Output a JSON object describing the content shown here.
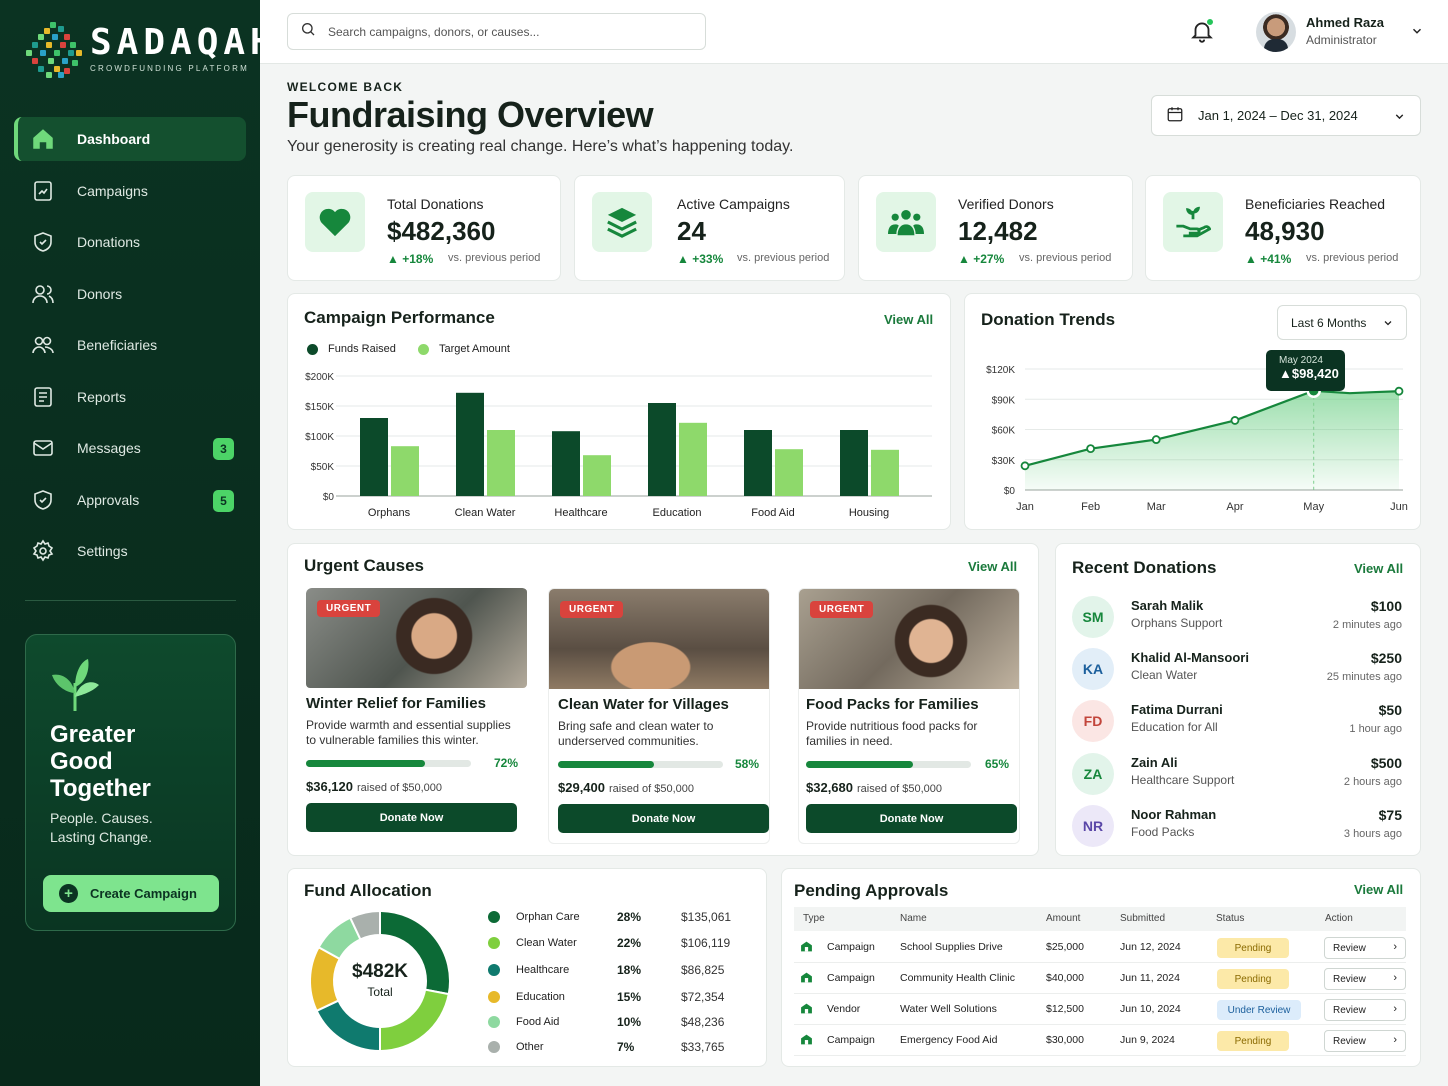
{
  "app": {
    "name": "SADAQAH",
    "tagline": "CROWDFUNDING PLATFORM"
  },
  "sidebar": {
    "items": [
      {
        "label": "Dashboard",
        "icon": "home-icon",
        "active": true
      },
      {
        "label": "Campaigns",
        "icon": "campaign-icon"
      },
      {
        "label": "Donations",
        "icon": "shield-heart-icon"
      },
      {
        "label": "Donors",
        "icon": "users-icon"
      },
      {
        "label": "Beneficiaries",
        "icon": "people-icon"
      },
      {
        "label": "Reports",
        "icon": "report-icon"
      },
      {
        "label": "Messages",
        "icon": "mail-icon",
        "badge": "3"
      },
      {
        "label": "Approvals",
        "icon": "shield-check-icon",
        "badge": "5"
      },
      {
        "label": "Settings",
        "icon": "gear-icon"
      }
    ],
    "promo": {
      "title": "Greater\nGood\nTogether",
      "subtitle": "People. Causes.\nLasting Change.",
      "button": "Create Campaign"
    }
  },
  "topbar": {
    "search_placeholder": "Search campaigns, donors, or causes...",
    "user": {
      "name": "Ahmed Raza",
      "role": "Administrator"
    }
  },
  "header": {
    "welcome": "WELCOME BACK",
    "title": "Fundraising Overview",
    "subtitle": "Your generosity is creating real change. Here’s what’s happening today.",
    "date_range": "Jan 1, 2024 – Dec 31, 2024"
  },
  "stats": [
    {
      "label": "Total Donations",
      "value": "$482,360",
      "change": "+18%",
      "note": "vs. previous period",
      "icon": "heart-icon"
    },
    {
      "label": "Active Campaigns",
      "value": "24",
      "change": "+33%",
      "note": "vs. previous period",
      "icon": "layers-icon"
    },
    {
      "label": "Verified Donors",
      "value": "12,482",
      "change": "+27%",
      "note": "vs. previous period",
      "icon": "group-icon"
    },
    {
      "label": "Beneficiaries Reached",
      "value": "48,930",
      "change": "+41%",
      "note": "vs. previous period",
      "icon": "hand-plant-icon"
    }
  ],
  "campaign_performance": {
    "title": "Campaign Performance",
    "view_all": "View All",
    "legend": [
      "Funds Raised",
      "Target Amount"
    ]
  },
  "donation_trends": {
    "title": "Donation Trends",
    "filter": "Last 6 Months",
    "tooltip": {
      "label": "May 2024",
      "value": "$98,420"
    }
  },
  "chart_data": [
    {
      "type": "bar",
      "categories": [
        "Orphans",
        "Clean Water",
        "Healthcare",
        "Education",
        "Food Aid",
        "Housing"
      ],
      "series": [
        {
          "name": "Funds Raised",
          "values": [
            130000,
            172000,
            108000,
            155000,
            110000,
            110000
          ]
        },
        {
          "name": "Target Amount",
          "values": [
            83000,
            110000,
            68000,
            122000,
            78000,
            77000
          ]
        }
      ],
      "yticks": [
        "$0",
        "$50K",
        "$100K",
        "$150K",
        "$200K"
      ],
      "ylim": [
        0,
        200000
      ],
      "colors": [
        "#0c4a2a",
        "#8ed96b"
      ]
    },
    {
      "type": "area",
      "x": [
        "Jan",
        "Feb",
        "Mar",
        "Apr",
        "May",
        "Jun"
      ],
      "xpos": [
        0,
        1,
        2,
        3.2,
        4.4,
        5.7
      ],
      "values": [
        24000,
        41000,
        50000,
        69000,
        98420,
        98000
      ],
      "extra_points": [
        {
          "x": 4.95,
          "y": 96000
        },
        {
          "x": 5.3,
          "y": 97000
        }
      ],
      "yticks": [
        "$0",
        "$30K",
        "$60K",
        "$90K",
        "$120K"
      ],
      "ylim": [
        0,
        120000
      ],
      "color": "#16873c"
    },
    {
      "type": "pie",
      "categories": [
        "Orphan Care",
        "Clean Water",
        "Healthcare",
        "Education",
        "Food Aid",
        "Other"
      ],
      "values": [
        28,
        22,
        18,
        15,
        10,
        7
      ],
      "colors": [
        "#0c6a36",
        "#7fcf3e",
        "#0f7a6e",
        "#e7b92a",
        "#8ed9a0",
        "#a9b0ac"
      ]
    }
  ],
  "urgent_causes": {
    "title": "Urgent Causes",
    "view_all": "View All",
    "tag": "URGENT",
    "items": [
      {
        "title": "Winter Relief for Families",
        "desc": "Provide warmth and essential supplies to vulnerable families this winter.",
        "progress": 0.72,
        "pct": "72%",
        "raised": "$36,120",
        "of": "raised of $50,000",
        "button": "Donate Now"
      },
      {
        "title": "Clean Water for Villages",
        "desc": "Bring safe and clean water to underserved communities.",
        "progress": 0.58,
        "pct": "58%",
        "raised": "$29,400",
        "of": "raised of $50,000",
        "button": "Donate Now"
      },
      {
        "title": "Food Packs for Families",
        "desc": "Provide nutritious food packs for families in need.",
        "progress": 0.65,
        "pct": "65%",
        "raised": "$32,680",
        "of": "raised of $50,000",
        "button": "Donate Now"
      }
    ]
  },
  "recent_donations": {
    "title": "Recent Donations",
    "view_all": "View All",
    "items": [
      {
        "initials": "SM",
        "name": "Sarah Malik",
        "cause": "Orphans Support",
        "amount": "$100",
        "time": "2 minutes ago",
        "bg": "#e2f4ea",
        "fg": "#16873c"
      },
      {
        "initials": "KA",
        "name": "Khalid Al-Mansoori",
        "cause": "Clean Water",
        "amount": "$250",
        "time": "25 minutes ago",
        "bg": "#e2eef8",
        "fg": "#1b5f9c"
      },
      {
        "initials": "FD",
        "name": "Fatima Durrani",
        "cause": "Education for All",
        "amount": "$50",
        "time": "1 hour ago",
        "bg": "#fbe6e4",
        "fg": "#c2453b"
      },
      {
        "initials": "ZA",
        "name": "Zain Ali",
        "cause": "Healthcare Support",
        "amount": "$500",
        "time": "2 hours ago",
        "bg": "#e2f4ea",
        "fg": "#16873c"
      },
      {
        "initials": "NR",
        "name": "Noor Rahman",
        "cause": "Food Packs",
        "amount": "$75",
        "time": "3 hours ago",
        "bg": "#ece8f8",
        "fg": "#5a47a8"
      }
    ]
  },
  "fund_allocation": {
    "title": "Fund Allocation",
    "center_value": "$482K",
    "center_label": "Total",
    "rows": [
      {
        "name": "Orphan Care",
        "pct": "28%",
        "amount": "$135,061"
      },
      {
        "name": "Clean Water",
        "pct": "22%",
        "amount": "$106,119"
      },
      {
        "name": "Healthcare",
        "pct": "18%",
        "amount": "$86,825"
      },
      {
        "name": "Education",
        "pct": "15%",
        "amount": "$72,354"
      },
      {
        "name": "Food Aid",
        "pct": "10%",
        "amount": "$48,236"
      },
      {
        "name": "Other",
        "pct": "7%",
        "amount": "$33,765"
      }
    ]
  },
  "pending_approvals": {
    "title": "Pending Approvals",
    "view_all": "View All",
    "columns": [
      "Type",
      "Name",
      "Amount",
      "Submitted",
      "Status",
      "Action"
    ],
    "rows": [
      {
        "type": "Campaign",
        "name": "School Supplies Drive",
        "amount": "$25,000",
        "submitted": "Jun 12, 2024",
        "status": "Pending",
        "action": "Review"
      },
      {
        "type": "Campaign",
        "name": "Community Health Clinic",
        "amount": "$40,000",
        "submitted": "Jun 11, 2024",
        "status": "Pending",
        "action": "Review"
      },
      {
        "type": "Vendor",
        "name": "Water Well Solutions",
        "amount": "$12,500",
        "submitted": "Jun 10, 2024",
        "status": "Under Review",
        "action": "Review"
      },
      {
        "type": "Campaign",
        "name": "Emergency Food Aid",
        "amount": "$30,000",
        "submitted": "Jun 9, 2024",
        "status": "Pending",
        "action": "Review"
      }
    ]
  }
}
